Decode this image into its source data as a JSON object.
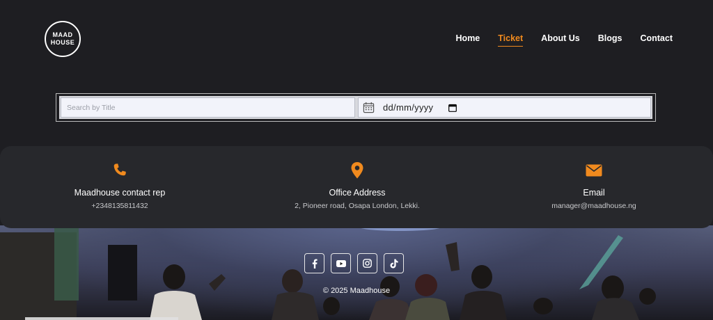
{
  "brand": {
    "line1": "MAAD",
    "line2": "HOUSE"
  },
  "nav": {
    "items": [
      {
        "label": "Home",
        "active": false
      },
      {
        "label": "Ticket",
        "active": true
      },
      {
        "label": "About Us",
        "active": false
      },
      {
        "label": "Blogs",
        "active": false
      },
      {
        "label": "Contact",
        "active": false
      }
    ]
  },
  "filter": {
    "search_placeholder": "Search by Title",
    "date_value": "dd/mm/yyyy"
  },
  "contact": {
    "phone": {
      "icon": "phone-icon",
      "title": "Maadhouse contact rep",
      "value": "+2348135811432"
    },
    "address": {
      "icon": "map-pin-icon",
      "title": "Office Address",
      "value": "2, Pioneer road, Osapa London, Lekki."
    },
    "email": {
      "icon": "envelope-icon",
      "title": "Email",
      "value": "manager@maadhouse.ng"
    }
  },
  "footer": {
    "socials": [
      "facebook-icon",
      "youtube-icon",
      "instagram-icon",
      "tiktok-icon"
    ],
    "copyright": "© 2025 Maadhouse"
  },
  "colors": {
    "accent": "#f08a1e",
    "background": "#1e1e22",
    "card": "#27282c"
  }
}
